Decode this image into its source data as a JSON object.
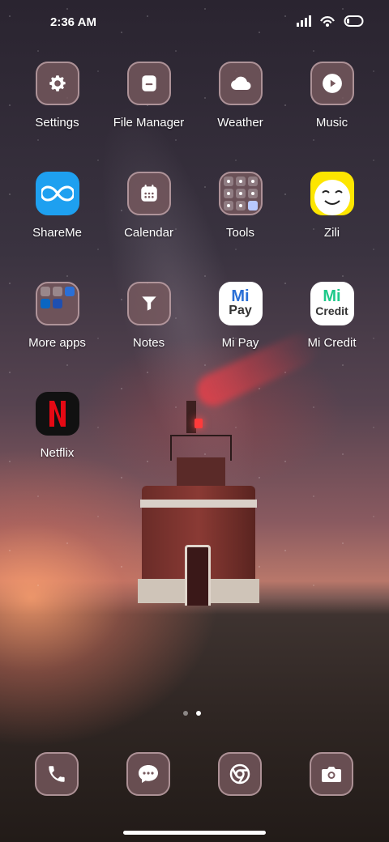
{
  "status_bar": {
    "time": "2:36 AM"
  },
  "apps": [
    {
      "label": "Settings"
    },
    {
      "label": "File Manager"
    },
    {
      "label": "Weather"
    },
    {
      "label": "Music"
    },
    {
      "label": "ShareMe"
    },
    {
      "label": "Calendar"
    },
    {
      "label": "Tools"
    },
    {
      "label": "Zili"
    },
    {
      "label": "More apps"
    },
    {
      "label": "Notes"
    },
    {
      "label": "Mi Pay",
      "icon_text": [
        "Mi",
        "Pay"
      ]
    },
    {
      "label": "Mi Credit",
      "icon_text": [
        "Mi",
        "Credit"
      ]
    },
    {
      "label": "Netflix"
    }
  ],
  "dock": [
    {
      "icon": "phone-icon"
    },
    {
      "icon": "messages-icon"
    },
    {
      "icon": "chrome-icon"
    },
    {
      "icon": "camera-icon"
    }
  ],
  "pages": {
    "count": 2,
    "active": 2
  },
  "colors": {
    "icon_bg": "#785a5f",
    "accent_green": "#1ec98a",
    "accent_blue": "#2a6fd6",
    "netflix_red": "#e50914"
  }
}
